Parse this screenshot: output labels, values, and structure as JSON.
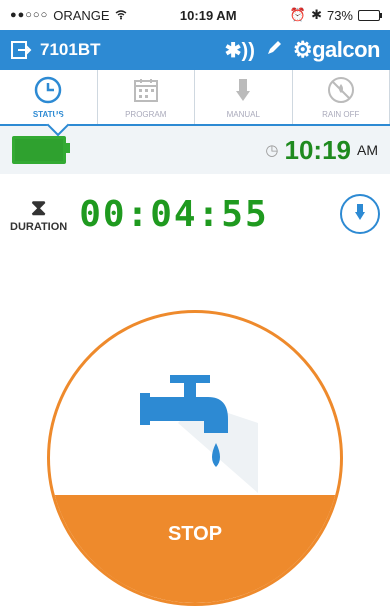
{
  "statusbar": {
    "carrier": "ORANGE",
    "time": "10:19 AM",
    "battery": "73%"
  },
  "header": {
    "device_name": "7101BT",
    "brand": "galcon",
    "icons": [
      "exit-icon",
      "bluetooth-icon",
      "edit-icon"
    ]
  },
  "tabs": [
    {
      "label": "STATUS",
      "icon": "clock-icon",
      "active": true
    },
    {
      "label": "PROGRAM",
      "icon": "calendar-icon",
      "active": false
    },
    {
      "label": "MANUAL",
      "icon": "hand-icon",
      "active": false
    },
    {
      "label": "RAIN OFF",
      "icon": "rain-off-icon",
      "active": false
    }
  ],
  "info": {
    "time": "10:19",
    "ampm": "AM"
  },
  "duration": {
    "label": "DURATION",
    "value": "00:04:55"
  },
  "action": {
    "stop_label": "STOP"
  },
  "colors": {
    "primary": "#2d8ad3",
    "accent": "#ee8a2c",
    "green": "#1f9a1f"
  }
}
